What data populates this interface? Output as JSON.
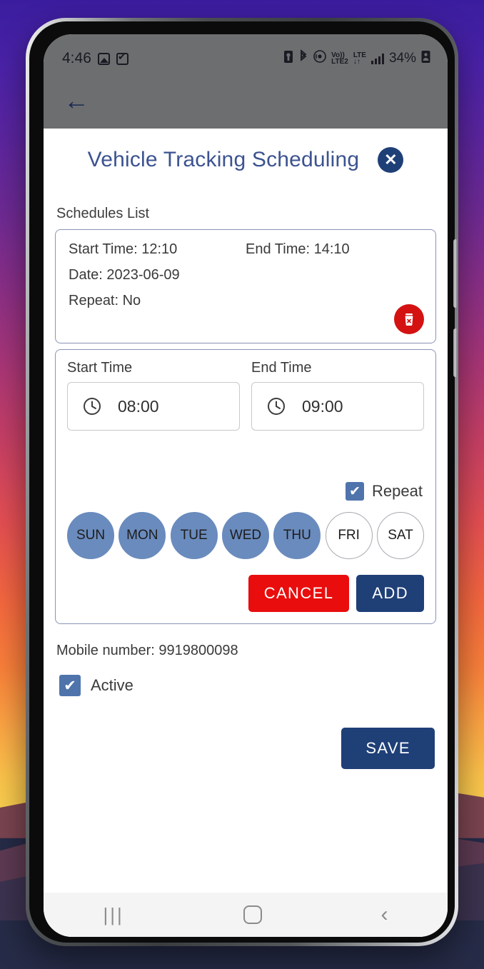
{
  "status_bar": {
    "time": "4:46",
    "icons_left": [
      "image-icon",
      "checkbox-icon"
    ],
    "icons_right": [
      "sim-icon",
      "bluetooth-icon",
      "hotspot-icon",
      "volte-icon",
      "lte-icon",
      "signal-icon"
    ],
    "volte_top": "Vo))",
    "volte_bottom": "LTE2",
    "lte_top": "LTE",
    "lte_bottom": "↓↑",
    "battery": "34%",
    "battery_icon": "battery-person-icon"
  },
  "app_bar": {
    "back_icon": "back-arrow-icon"
  },
  "header": {
    "title": "Vehicle Tracking Scheduling",
    "close_label": "✕",
    "close_icon": "close-circle-icon"
  },
  "schedules": {
    "section_label": "Schedules List",
    "items": [
      {
        "start_time": "Start Time: 12:10",
        "end_time": "End Time: 14:10",
        "date": "Date: 2023-06-09",
        "repeat": "Repeat: No",
        "delete_icon": "trash-delete-icon"
      }
    ]
  },
  "form": {
    "start_time_label": "Start Time",
    "end_time_label": "End Time",
    "start_time_value": "08:00",
    "end_time_value": "09:00",
    "start_time_icon": "clock-icon",
    "end_time_icon": "clock-icon",
    "repeat_label": "Repeat",
    "repeat_checked": true,
    "days": [
      {
        "label": "SUN",
        "selected": true
      },
      {
        "label": "MON",
        "selected": true
      },
      {
        "label": "TUE",
        "selected": true
      },
      {
        "label": "WED",
        "selected": true
      },
      {
        "label": "THU",
        "selected": true
      },
      {
        "label": "FRI",
        "selected": false
      },
      {
        "label": "SAT",
        "selected": false
      }
    ],
    "cancel_label": "CANCEL",
    "add_label": "ADD"
  },
  "footer": {
    "mobile_number": "Mobile number: 9919800098",
    "active_label": "Active",
    "active_checked": true,
    "save_label": "SAVE"
  },
  "nav_bar": {
    "recents": "|||",
    "recents_icon": "recents-icon",
    "home_icon": "home-icon",
    "back": "‹",
    "back_icon": "nav-back-icon"
  },
  "colors": {
    "brand_navy": "#1f3f77",
    "title_blue": "#3c5390",
    "danger_red": "#e90d0d",
    "delete_red": "#d41212",
    "day_selected": "#6a8bbd",
    "checkbox_blue": "#4f74ac",
    "card_border": "#8a93b5"
  }
}
